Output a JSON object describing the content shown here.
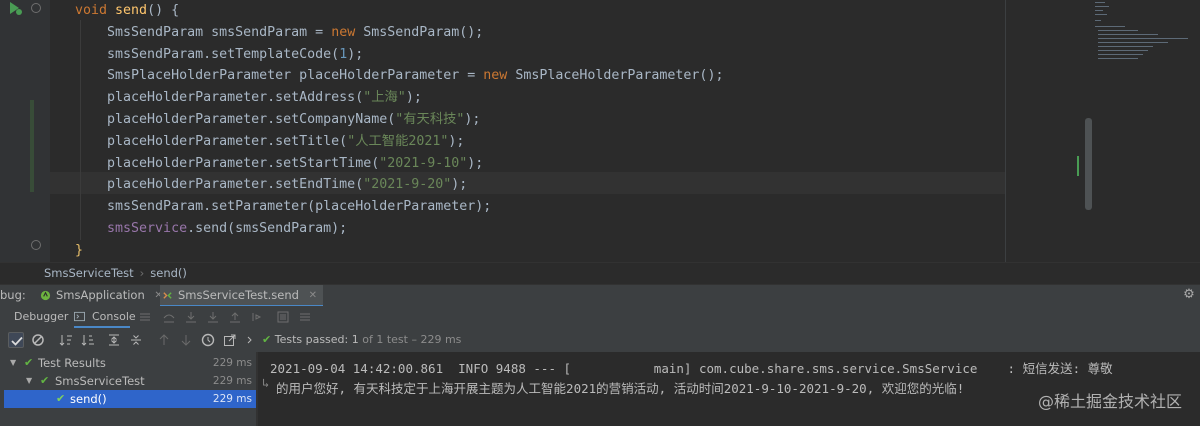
{
  "editor": {
    "lines": [
      [
        {
          "c": "kw",
          "t": "void "
        },
        {
          "c": "fn",
          "t": "send"
        },
        {
          "c": "tx",
          "t": "() {"
        }
      ],
      [
        {
          "c": "tx",
          "t": "    SmsSendParam smsSendParam = "
        },
        {
          "c": "kw",
          "t": "new "
        },
        {
          "c": "tx",
          "t": "SmsSendParam();"
        }
      ],
      [
        {
          "c": "tx",
          "t": "    smsSendParam.setTemplateCode("
        },
        {
          "c": "nu",
          "t": "1"
        },
        {
          "c": "tx",
          "t": ");"
        }
      ],
      [
        {
          "c": "tx",
          "t": "    SmsPlaceHolderParameter placeHolderParameter = "
        },
        {
          "c": "kw",
          "t": "new "
        },
        {
          "c": "tx",
          "t": "SmsPlaceHolderParameter();"
        }
      ],
      [
        {
          "c": "tx",
          "t": "    placeHolderParameter.setAddress("
        },
        {
          "c": "st",
          "t": "\"上海\""
        },
        {
          "c": "tx",
          "t": ");"
        }
      ],
      [
        {
          "c": "tx",
          "t": "    placeHolderParameter.setCompanyName("
        },
        {
          "c": "st",
          "t": "\"有天科技\""
        },
        {
          "c": "tx",
          "t": ");"
        }
      ],
      [
        {
          "c": "tx",
          "t": "    placeHolderParameter.setTitle("
        },
        {
          "c": "st",
          "t": "\"人工智能2021\""
        },
        {
          "c": "tx",
          "t": ");"
        }
      ],
      [
        {
          "c": "tx",
          "t": "    placeHolderParameter.setStartTime("
        },
        {
          "c": "st",
          "t": "\"2021-9-10\""
        },
        {
          "c": "tx",
          "t": ");"
        }
      ],
      [
        {
          "c": "tx",
          "t": "    placeHolderParameter.setEndTime("
        },
        {
          "c": "st",
          "t": "\"2021-9-20\""
        },
        {
          "c": "tx",
          "t": ");"
        }
      ],
      [
        {
          "c": "tx",
          "t": "    smsSendParam.setParameter(placeHolderParameter);"
        }
      ],
      [
        {
          "c": "fd",
          "t": "    smsService"
        },
        {
          "c": "tx",
          "t": ".send(smsSendParam);"
        }
      ],
      [
        {
          "c": "yel",
          "t": "}"
        }
      ]
    ]
  },
  "breadcrumb": {
    "class_name": "SmsServiceTest",
    "method_name": "send()"
  },
  "debug_bar": {
    "label": "bug:",
    "tabs": [
      {
        "label": "SmsApplication",
        "icon": "spring-boot-icon"
      },
      {
        "label": "SmsServiceTest.send",
        "icon": "test-run-icon"
      }
    ]
  },
  "tool_tabs": {
    "debugger": "Debugger",
    "console": "Console"
  },
  "test_status": {
    "prefix": "Tests passed: ",
    "count": "1",
    "suffix": " of 1 test – 229 ms"
  },
  "test_tree": [
    {
      "label": "Test Results",
      "time": "229 ms"
    },
    {
      "label": "SmsServiceTest",
      "time": "229 ms"
    },
    {
      "label": "send()",
      "time": "229 ms"
    }
  ],
  "console": {
    "line1": "2021-09-04 14:42:00.861  INFO 9488 --- [           main] com.cube.share.sms.service.SmsService    : 短信发送: 尊敬",
    "line2": "的用户您好, 有天科技定于上海开展主题为人工智能2021的营销活动, 活动时间2021-9-10-2021-9-20, 欢迎您的光临!"
  },
  "watermark": "@稀土掘金技术社区",
  "colors": {
    "accent": "#4a88c7",
    "success": "#62b543",
    "selection": "#2f65ca"
  }
}
